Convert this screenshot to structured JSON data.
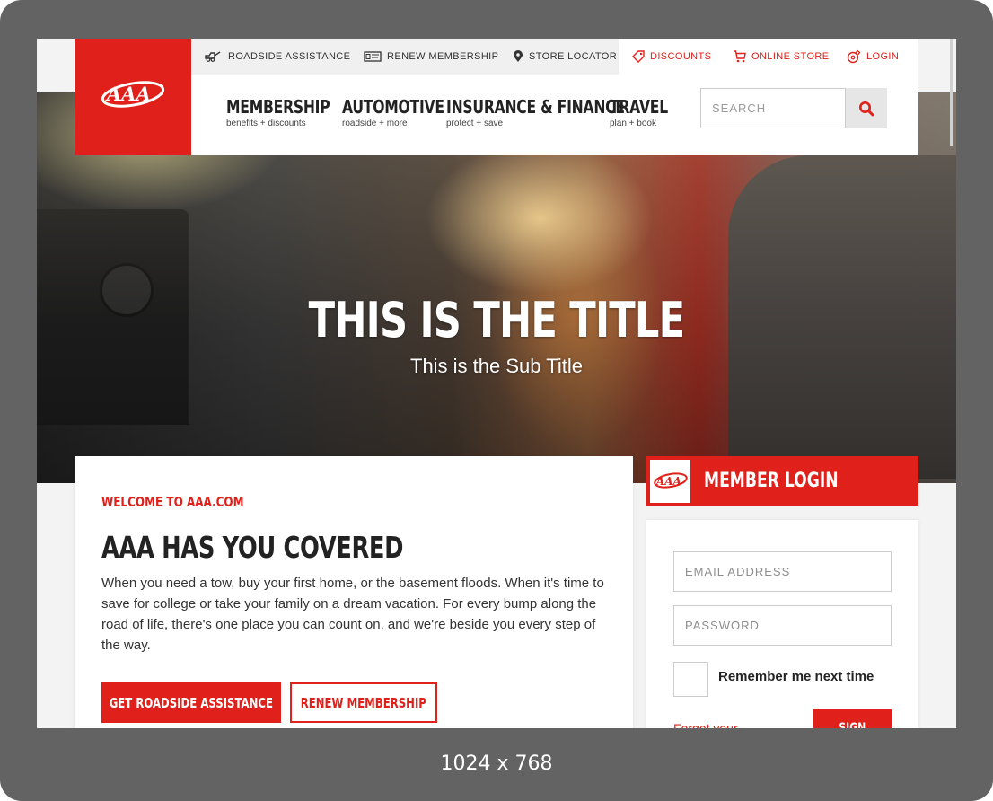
{
  "device": {
    "caption": "1024 x 768"
  },
  "colors": {
    "brand_red": "#e0201a",
    "frame": "#636363"
  },
  "utility_nav": [
    {
      "label": "ROADSIDE ASSISTANCE",
      "icon": "tow-truck-icon"
    },
    {
      "label": "RENEW MEMBERSHIP",
      "icon": "membership-card-icon"
    },
    {
      "label": "STORE LOCATOR",
      "icon": "location-pin-icon"
    },
    {
      "label": "DISCOUNTS",
      "icon": "tag-icon"
    },
    {
      "label": "ONLINE STORE",
      "icon": "cart-icon"
    },
    {
      "label": "LOGIN",
      "icon": "login-lock-icon"
    }
  ],
  "main_nav": [
    {
      "title": "MEMBERSHIP",
      "sub": "benefits + discounts"
    },
    {
      "title": "AUTOMOTIVE",
      "sub": "roadside + more"
    },
    {
      "title": "INSURANCE & FINANCE",
      "sub": "protect + save"
    },
    {
      "title": "TRAVEL",
      "sub": "plan + book"
    }
  ],
  "search": {
    "placeholder": "SEARCH"
  },
  "hero": {
    "title": "THIS IS THE TITLE",
    "subtitle": "This is the Sub Title"
  },
  "welcome": {
    "eyebrow": "WELCOME TO AAA.COM",
    "heading": "AAA HAS YOU COVERED",
    "body": "When you need a tow, buy your first home, or the basement floods. When it's time to save for college or take your family on a dream vacation. For every bump along the road of life, there's one place you can count on, and we're beside you every step of the way.",
    "primary_button": "GET ROADSIDE ASSISTANCE",
    "secondary_button": "RENEW MEMBERSHIP"
  },
  "login": {
    "title": "MEMBER LOGIN",
    "email_placeholder": "EMAIL ADDRESS",
    "password_placeholder": "PASSWORD",
    "remember_label": "Remember me next time",
    "forgot_link": "Forgot your",
    "sign_button": "SIGN"
  }
}
